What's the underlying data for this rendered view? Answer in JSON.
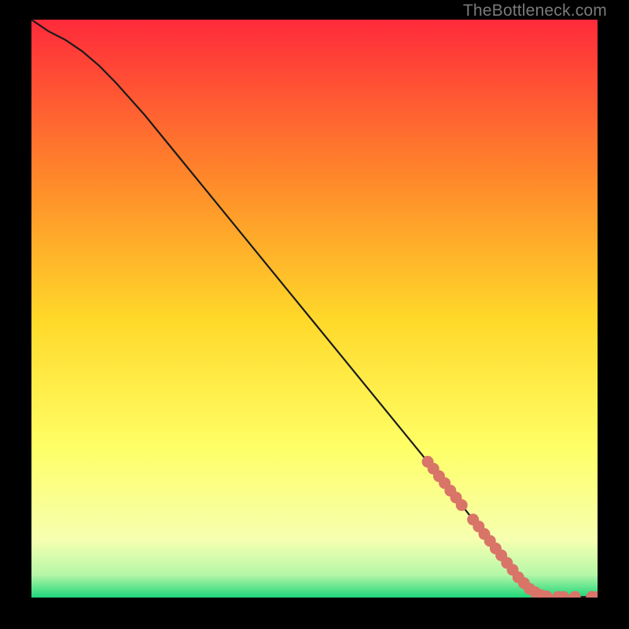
{
  "watermark": "TheBottleneck.com",
  "colors": {
    "bg": "#000000",
    "curve": "#1b1b1b",
    "marker_fill": "#d97468",
    "marker_stroke": "#b85648",
    "grad_top": "#ff2a3b",
    "grad_mid_upper": "#ff8a2a",
    "grad_mid": "#ffd92a",
    "grad_mid_lower": "#ffff66",
    "grad_pale": "#f6ffb0",
    "grad_green_light": "#b7f7a8",
    "grad_green": "#1fd67a"
  },
  "chart_data": {
    "type": "line",
    "title": "",
    "xlabel": "",
    "ylabel": "",
    "xlim": [
      0,
      100
    ],
    "ylim": [
      0,
      100
    ],
    "series": [
      {
        "name": "bottleneck-curve",
        "x": [
          0,
          3,
          6,
          9,
          12,
          15,
          20,
          25,
          30,
          35,
          40,
          45,
          50,
          55,
          60,
          65,
          70,
          72,
          74,
          76,
          78,
          80,
          82,
          84,
          86,
          88,
          90,
          92,
          93,
          100
        ],
        "y": [
          100,
          98,
          96.5,
          94.5,
          92,
          89,
          83.5,
          77.5,
          71.5,
          65.5,
          59.5,
          53.5,
          47.5,
          41.5,
          35.5,
          29.5,
          23.5,
          21,
          18.5,
          16,
          13.5,
          11,
          8.5,
          6,
          3.5,
          1.5,
          0.4,
          0.15,
          0.1,
          0.1
        ]
      }
    ],
    "markers": {
      "name": "highlighted-points",
      "x": [
        70,
        71,
        72,
        73,
        74,
        75,
        76,
        78,
        79,
        80,
        81,
        82,
        83,
        84,
        85,
        86,
        87,
        88,
        89,
        90,
        91,
        93,
        94,
        96,
        99,
        100
      ],
      "y": [
        23.5,
        22.3,
        21.0,
        19.8,
        18.5,
        17.3,
        16.0,
        13.5,
        12.3,
        11.0,
        9.8,
        8.5,
        7.3,
        6.0,
        4.8,
        3.5,
        2.5,
        1.5,
        0.9,
        0.4,
        0.2,
        0.1,
        0.1,
        0.1,
        0.1,
        0.1
      ]
    }
  }
}
